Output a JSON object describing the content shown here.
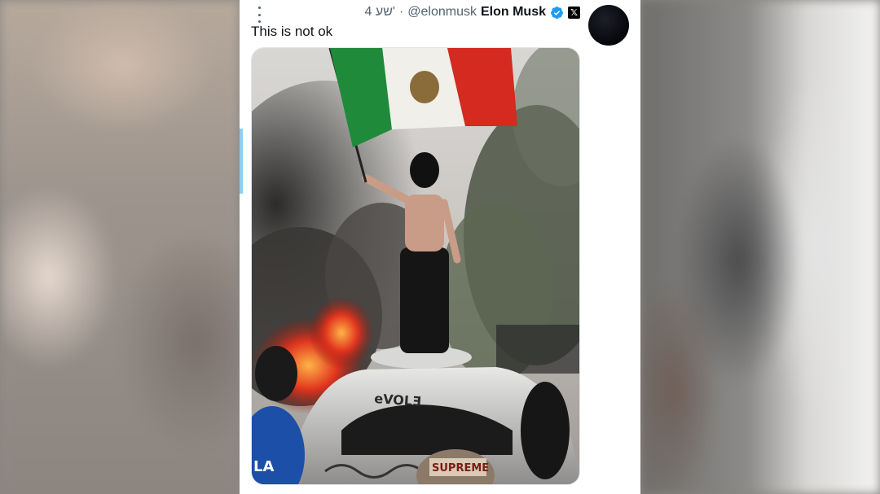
{
  "tweet": {
    "author_name": "Elon Musk",
    "handle": "@elonmusk",
    "separator": "·",
    "time": "4 שע'",
    "x_badge": "𝕏",
    "text": "This is not ok",
    "verified_color": "#1d9bf0",
    "media_alt_caption": [
      "eVOLƎ",
      "SUPREME",
      "LA"
    ]
  },
  "colors": {
    "text_primary": "#0f1419",
    "text_secondary": "#536471",
    "accent": "#8ecdf6"
  }
}
